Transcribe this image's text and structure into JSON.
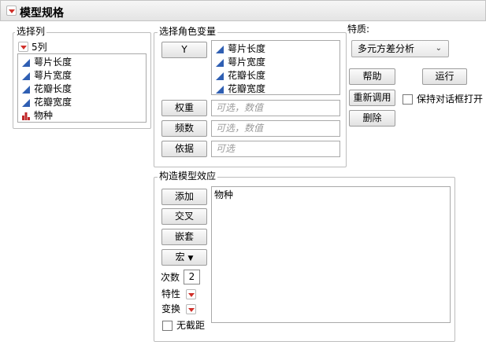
{
  "title": "模型规格",
  "select_columns": {
    "label": "选择列",
    "count_label": "5列",
    "columns": [
      {
        "name": "萼片长度",
        "icon": "continuous-icon"
      },
      {
        "name": "萼片宽度",
        "icon": "continuous-icon"
      },
      {
        "name": "花瓣长度",
        "icon": "continuous-icon"
      },
      {
        "name": "花瓣宽度",
        "icon": "continuous-icon"
      },
      {
        "name": "物种",
        "icon": "nominal-icon"
      }
    ]
  },
  "roles": {
    "label": "选择角色变量",
    "y_button": "Y",
    "y_items": [
      "萼片长度",
      "萼片宽度",
      "花瓣长度",
      "花瓣宽度"
    ],
    "weight_button": "权重",
    "weight_placeholder": "可选，数值",
    "freq_button": "频数",
    "freq_placeholder": "可选，数值",
    "by_button": "依据",
    "by_placeholder": "可选"
  },
  "personality": {
    "label": "特质:",
    "selected": "多元方差分析"
  },
  "actions": {
    "help": "帮助",
    "run": "运行",
    "recall": "重新调用",
    "keep_dialog": "保持对话框打开",
    "remove": "删除"
  },
  "effects": {
    "label": "构造模型效应",
    "add": "添加",
    "cross": "交叉",
    "nest": "嵌套",
    "macros": "宏",
    "degree_label": "次数",
    "degree_value": "2",
    "attributes_label": "特性",
    "transform_label": "变换",
    "no_intercept_label": "无截距",
    "items": [
      "物种"
    ]
  },
  "colors": {
    "accent_red": "#d0302a",
    "continuous_blue": "#2f5fb3",
    "nominal_red": "#c0282a"
  }
}
